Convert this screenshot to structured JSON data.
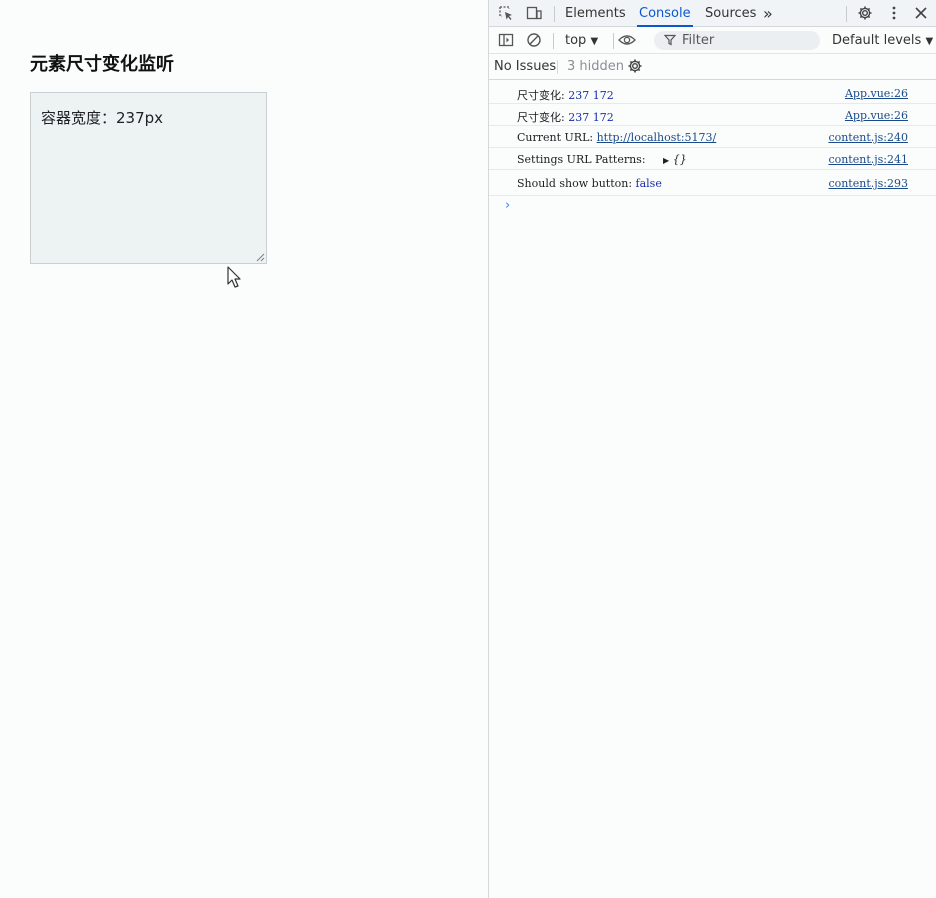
{
  "page": {
    "title": "元素尺寸变化监听",
    "box_text": "容器宽度：237px"
  },
  "devtools": {
    "tabs": [
      {
        "label": "Elements"
      },
      {
        "label": "Console"
      },
      {
        "label": "Sources"
      }
    ],
    "more_tabs": "»",
    "context": "top",
    "filter_placeholder": "Filter",
    "levels": "Default levels",
    "no_issues": "No Issues",
    "hidden": "3 hidden",
    "messages": [
      {
        "label": "尺寸变化:",
        "value": "237 172",
        "source": "App.vue:26"
      },
      {
        "label": "尺寸变化:",
        "value": "237 172",
        "source": "App.vue:26"
      },
      {
        "label": "Current URL:",
        "value": "http://localhost:5173/",
        "source": "content.js:240"
      },
      {
        "label": "Settings URL Patterns:",
        "value": "{}",
        "source": "content.js:241"
      },
      {
        "label": "Should show button:",
        "value": "false",
        "source": "content.js:293"
      }
    ],
    "prompt": "›"
  },
  "colors": {
    "accent": "#0b57d0",
    "number": "#1a2da8",
    "link": "#1a4a8a"
  }
}
